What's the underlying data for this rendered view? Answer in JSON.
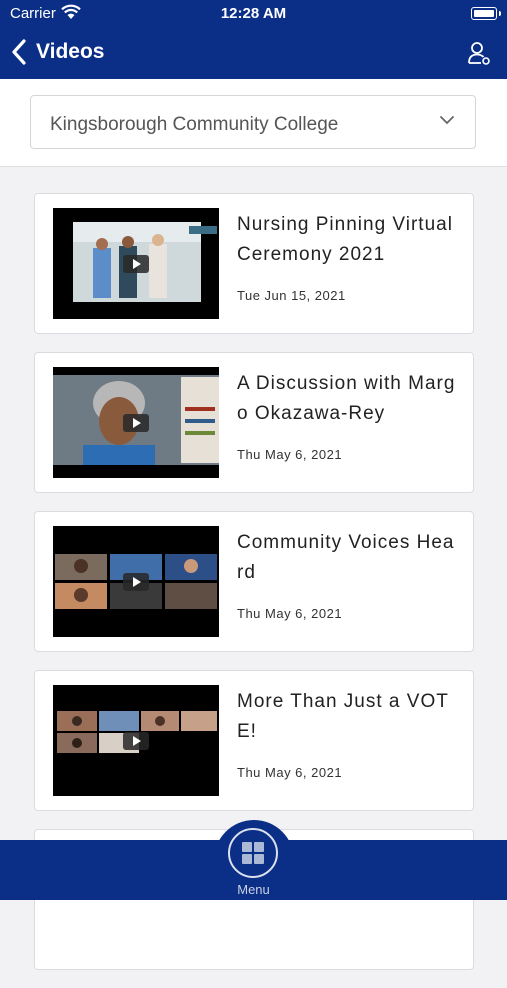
{
  "status_bar": {
    "carrier": "Carrier",
    "time": "12:28 AM"
  },
  "header": {
    "title": "Videos",
    "back_icon": "chevron-left-icon",
    "profile_icon": "user-profile-icon"
  },
  "picker": {
    "selected": "Kingsborough Community College"
  },
  "videos": [
    {
      "title": "Nursing Pinning Virtual Ceremony 2021",
      "date": "Tue Jun 15, 2021"
    },
    {
      "title": "A Discussion with Margo Okazawa-Rey",
      "date": "Thu May 6, 2021"
    },
    {
      "title": "Community Voices Heard",
      "date": "Thu May 6, 2021"
    },
    {
      "title": "More Than Just a VOTE!",
      "date": "Thu May 6, 2021"
    }
  ],
  "bottom_nav": {
    "menu_label": "Menu",
    "menu_icon": "grid-icon"
  },
  "colors": {
    "brand": "#0b2f86",
    "background": "#f2f2f4"
  }
}
